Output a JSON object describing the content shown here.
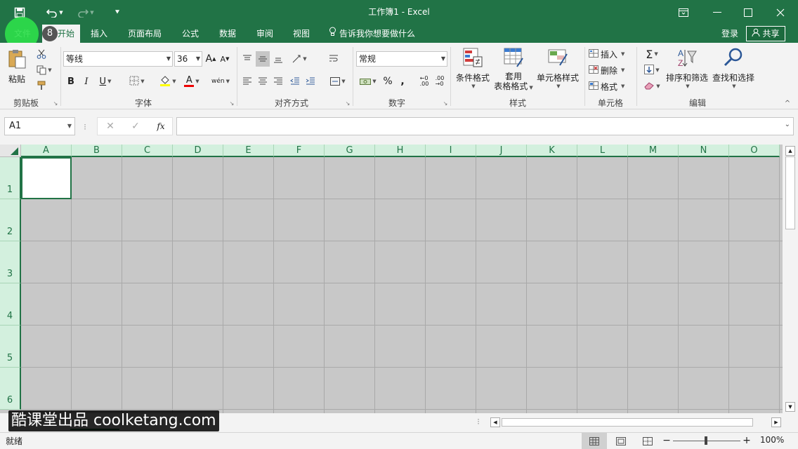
{
  "window": {
    "title": "工作簿1 - Excel"
  },
  "tabs": [
    {
      "label": "文件"
    },
    {
      "label": "开始"
    },
    {
      "label": "插入"
    },
    {
      "label": "页面布局"
    },
    {
      "label": "公式"
    },
    {
      "label": "数据"
    },
    {
      "label": "审阅"
    },
    {
      "label": "视图"
    }
  ],
  "tellme": "告诉我你想要做什么",
  "account": {
    "login": "登录",
    "share": "共享"
  },
  "badge": "8",
  "ribbon": {
    "clipboard": {
      "paste": "粘贴",
      "group": "剪贴板"
    },
    "font": {
      "name": "等线",
      "size": "36",
      "group": "字体",
      "bold": "B",
      "italic": "I",
      "underline": "U",
      "grow": "A",
      "shrink": "A",
      "color_a": "A",
      "phonetic": "wén"
    },
    "alignment": {
      "group": "对齐方式"
    },
    "number": {
      "format": "常规",
      "group": "数字",
      "percent": "%",
      "comma": ","
    },
    "styles": {
      "conditional": "条件格式",
      "table1": "套用",
      "table2": "表格格式",
      "cell_styles": "单元格样式",
      "group": "样式"
    },
    "cells": {
      "insert": "插入",
      "delete": "删除",
      "format": "格式",
      "group": "单元格"
    },
    "editing": {
      "sort": "排序和筛选",
      "find": "查找和选择",
      "group": "编辑",
      "sigma": "Σ"
    }
  },
  "formula_bar": {
    "name_box": "A1",
    "fx": "fx",
    "value": ""
  },
  "columns": [
    "A",
    "B",
    "C",
    "D",
    "E",
    "F",
    "G",
    "H",
    "I",
    "J",
    "K",
    "L",
    "M",
    "N",
    "O"
  ],
  "rows": [
    "1",
    "2",
    "3",
    "4",
    "5",
    "6"
  ],
  "status": {
    "ready": "就绪",
    "zoom": "100%",
    "zoom_minus": "−",
    "zoom_plus": "+"
  },
  "watermark": "酷课堂出品 coolketang.com",
  "colors": {
    "excel_green": "#217346",
    "header_bg": "#d3f0de",
    "grid_fill": "#c8c8c8"
  }
}
